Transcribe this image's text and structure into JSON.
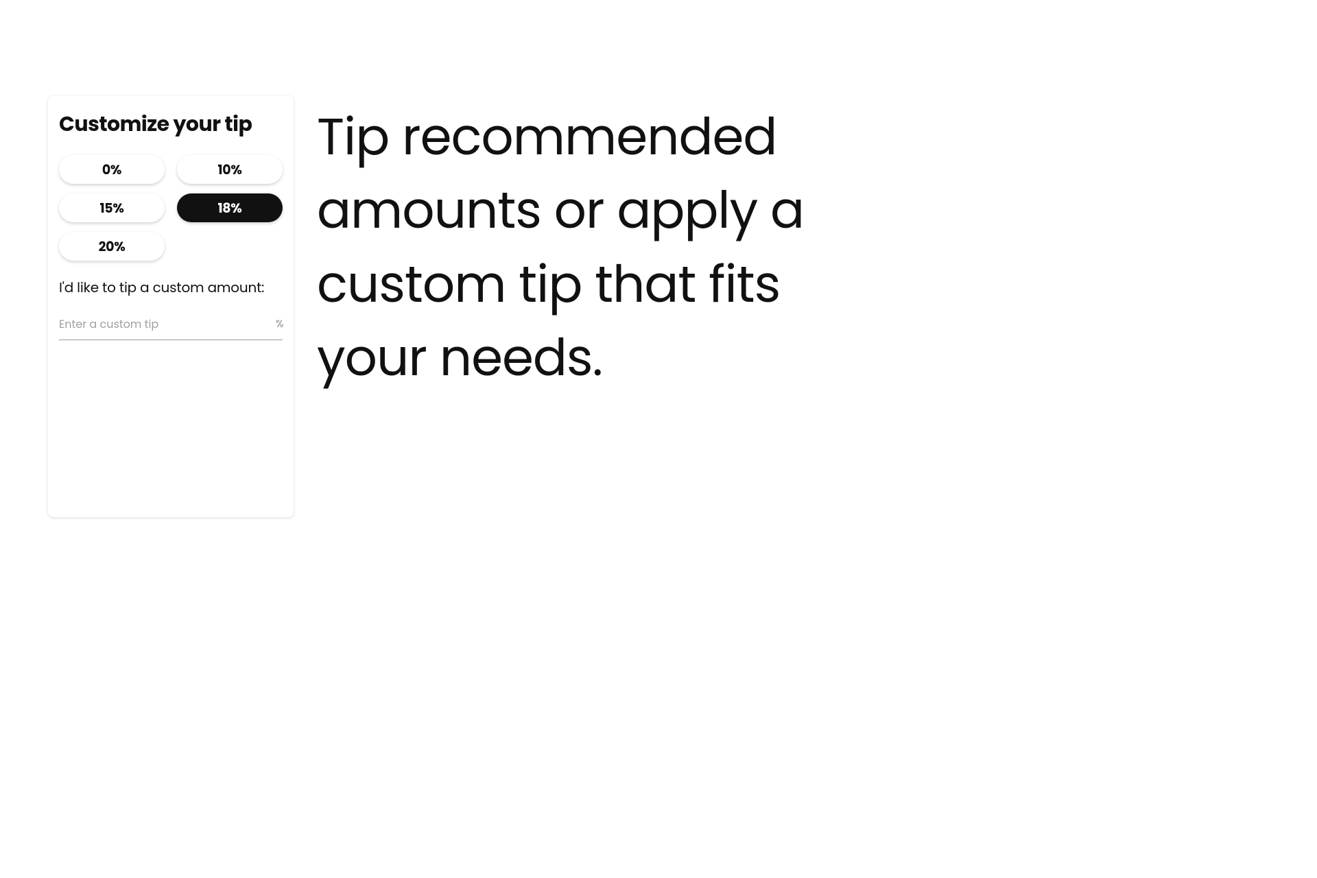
{
  "card": {
    "title": "Customize your tip",
    "tip_options": [
      {
        "label": "0%",
        "selected": false
      },
      {
        "label": "10%",
        "selected": false
      },
      {
        "label": "15%",
        "selected": false
      },
      {
        "label": "18%",
        "selected": true
      },
      {
        "label": "20%",
        "selected": false
      }
    ],
    "custom_label": "I'd like to tip a custom amount:",
    "input_placeholder": "Enter a custom tip",
    "percent_symbol": "%"
  },
  "description": "Tip recommended amounts or apply a custom tip that fits your needs."
}
